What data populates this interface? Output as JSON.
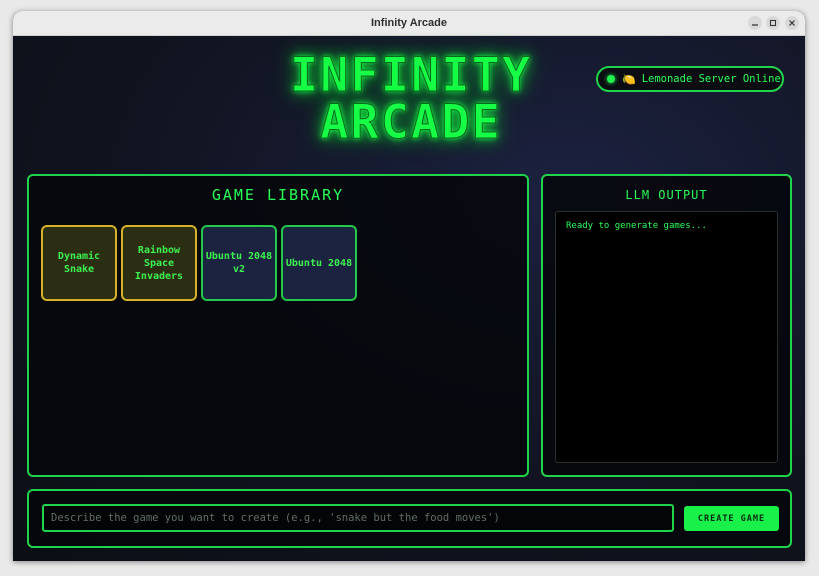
{
  "window": {
    "title": "Infinity Arcade",
    "controls": {
      "minimize": "minimize-icon",
      "maximize": "maximize-icon",
      "close": "close-icon"
    }
  },
  "header": {
    "logo_line1": "INFINITY",
    "logo_line2": "ARCADE",
    "status": {
      "emoji": "🍋",
      "text": "Lemonade Server Online",
      "color": "#22f04e"
    }
  },
  "library": {
    "title": "GAME LIBRARY",
    "games": [
      {
        "label": "Dynamic Snake",
        "style": "gold"
      },
      {
        "label": "Rainbow Space Invaders",
        "style": "gold"
      },
      {
        "label": "Ubuntu 2048 v2",
        "style": "blue"
      },
      {
        "label": "Ubuntu 2048",
        "style": "blue"
      }
    ]
  },
  "llm": {
    "title": "LLM OUTPUT",
    "output": "Ready to generate games..."
  },
  "prompt": {
    "placeholder": "Describe the game you want to create (e.g., 'snake but the food moves')",
    "value": "",
    "button": "CREATE GAME"
  },
  "colors": {
    "accent": "#1fd44a",
    "text_green": "#26ff55",
    "gold": "#d6b12a",
    "tile_blue": "#1c2340"
  }
}
